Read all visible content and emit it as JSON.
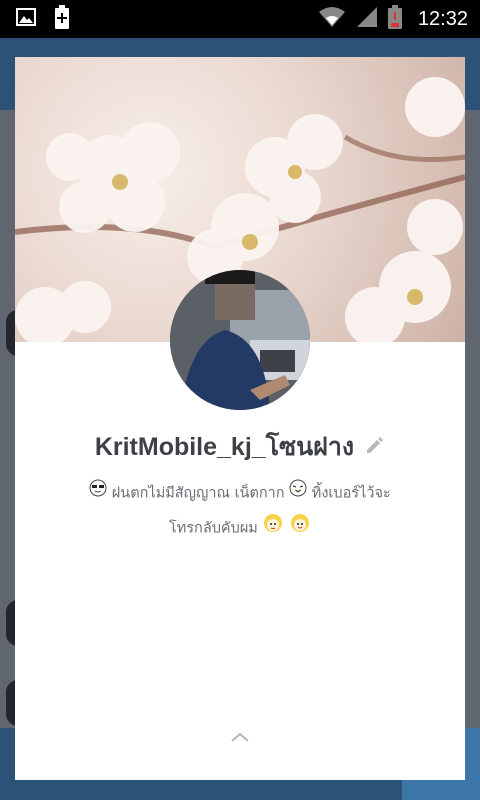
{
  "status_bar": {
    "time": "12:32",
    "icons": [
      "image-notification-icon",
      "battery-saver-icon",
      "wifi-icon",
      "signal-icon",
      "battery-low-icon"
    ]
  },
  "profile": {
    "name": "KritMobile_kj_โซนฝาง",
    "status_line1_a": "ฝนตกไม่มีสัญญาณ เน็ตกาก",
    "status_line1_b": "ทิ้งเบอร์ไว้จะ",
    "status_line2": "โทรกลับคับผม",
    "cover_theme": "cherry-blossoms",
    "avatar": "profile-photo"
  },
  "colors": {
    "name_text": "#3d4047",
    "status_text": "#6a6d73",
    "app_header": "#2c5377"
  }
}
